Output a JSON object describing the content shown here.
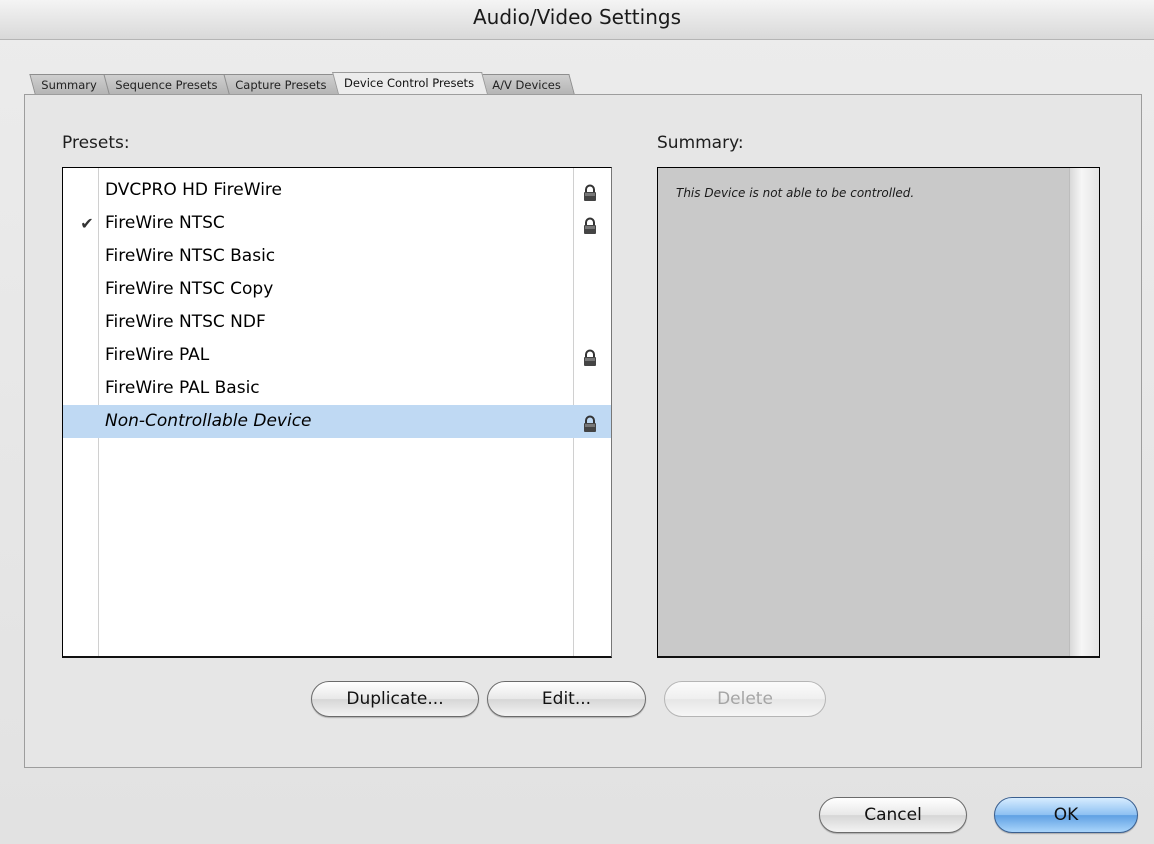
{
  "window": {
    "title": "Audio/Video Settings"
  },
  "tabs": [
    {
      "label": "Summary",
      "active": false
    },
    {
      "label": "Sequence Presets",
      "active": false
    },
    {
      "label": "Capture Presets",
      "active": false
    },
    {
      "label": "Device Control Presets",
      "active": true
    },
    {
      "label": "A/V Devices",
      "active": false
    }
  ],
  "presets": {
    "label": "Presets:",
    "items": [
      {
        "name": "DVCPRO HD FireWire",
        "checked": false,
        "locked": true,
        "selected": false,
        "italic": false
      },
      {
        "name": "FireWire NTSC",
        "checked": true,
        "locked": true,
        "selected": false,
        "italic": false
      },
      {
        "name": "FireWire NTSC Basic",
        "checked": false,
        "locked": false,
        "selected": false,
        "italic": false
      },
      {
        "name": "FireWire NTSC Copy",
        "checked": false,
        "locked": false,
        "selected": false,
        "italic": false
      },
      {
        "name": "FireWire NTSC NDF",
        "checked": false,
        "locked": false,
        "selected": false,
        "italic": false
      },
      {
        "name": "FireWire PAL",
        "checked": false,
        "locked": true,
        "selected": false,
        "italic": false
      },
      {
        "name": "FireWire PAL Basic",
        "checked": false,
        "locked": false,
        "selected": false,
        "italic": false
      },
      {
        "name": "Non-Controllable Device",
        "checked": false,
        "locked": true,
        "selected": true,
        "italic": true
      }
    ],
    "check_glyph": "✔"
  },
  "summary": {
    "label": "Summary:",
    "text": "This Device is not able to be controlled."
  },
  "buttons": {
    "duplicate": "Duplicate...",
    "edit": "Edit...",
    "delete": "Delete",
    "cancel": "Cancel",
    "ok": "OK"
  },
  "colors": {
    "selection": "#bfd9f3",
    "default_button": "#6aaae8"
  }
}
